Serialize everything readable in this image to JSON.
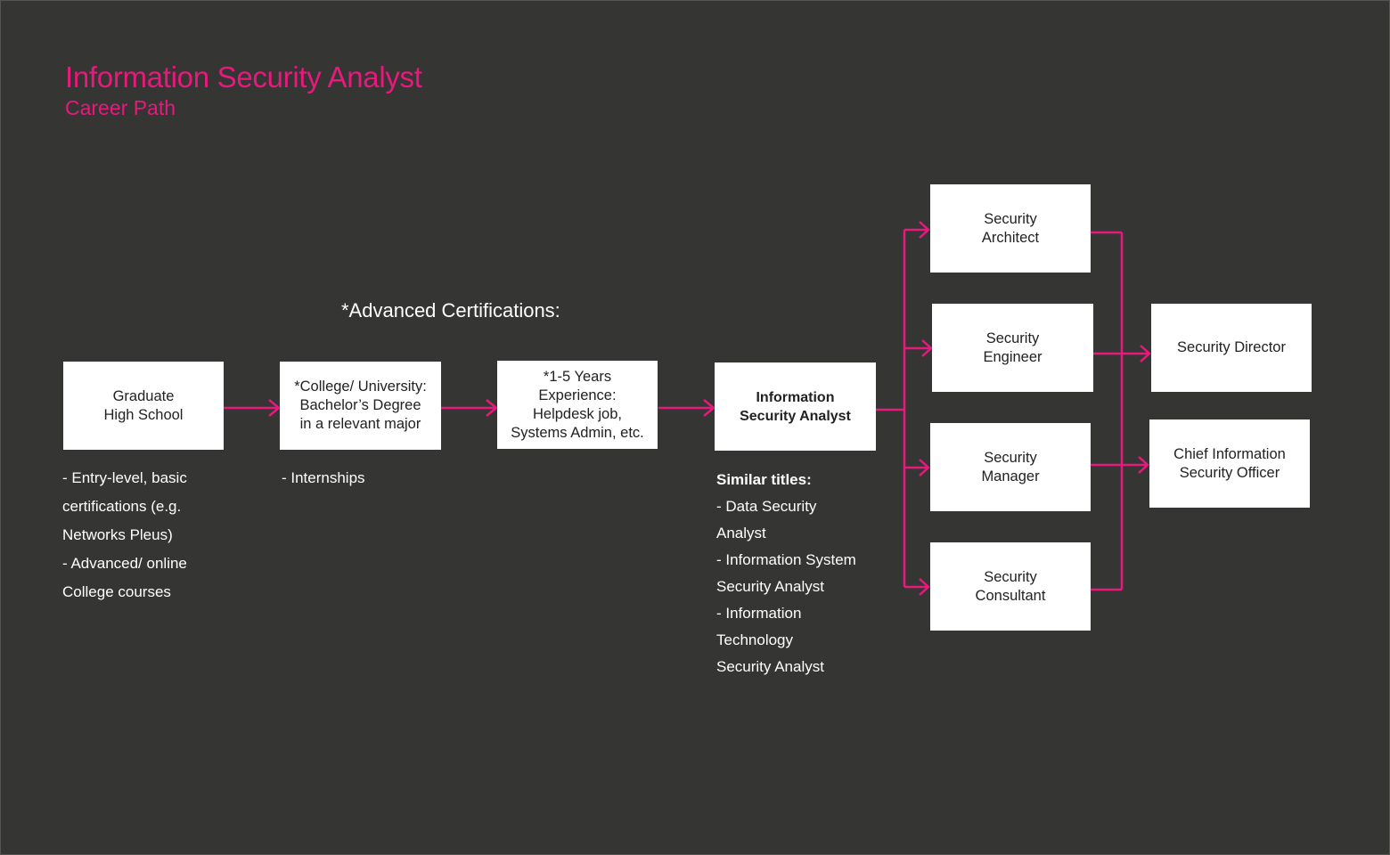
{
  "header": {
    "title": "Information Security Analyst",
    "subtitle": "Career Path"
  },
  "advanced_heading": "*Advanced Certifications:",
  "colors": {
    "background": "#353533",
    "accent": "#e8197d",
    "box": "#ffffff"
  },
  "steps": [
    {
      "id": "high-school",
      "label": "Graduate\nHigh School"
    },
    {
      "id": "college",
      "label": "*College/ University:\nBachelor’s Degree\nin a relevant major"
    },
    {
      "id": "experience",
      "label": "*1-5 Years\nExperience:\nHelpdesk job,\nSystems Admin, etc."
    },
    {
      "id": "analyst",
      "label": "Information\nSecurity Analyst"
    }
  ],
  "mid_roles": [
    {
      "id": "architect",
      "label": "Security\nArchitect"
    },
    {
      "id": "engineer",
      "label": "Security\nEngineer"
    },
    {
      "id": "manager",
      "label": "Security\nManager"
    },
    {
      "id": "consultant",
      "label": "Security\nConsultant"
    }
  ],
  "senior_roles": [
    {
      "id": "director",
      "label": "Security Director"
    },
    {
      "id": "ciso",
      "label": "Chief Information\nSecurity Officer"
    }
  ],
  "notes": {
    "high_school": "- Entry-level, basic\ncertifications (e.g.\nNetworks Pleus)\n- Advanced/ online\nCollege courses",
    "college": "- Internships",
    "similar_titles_heading": "Similar titles:",
    "similar_titles": [
      "- Data Security",
      "Analyst",
      "- Information System",
      "Security Analyst",
      "- Information",
      "Technology",
      "Security Analyst"
    ]
  }
}
